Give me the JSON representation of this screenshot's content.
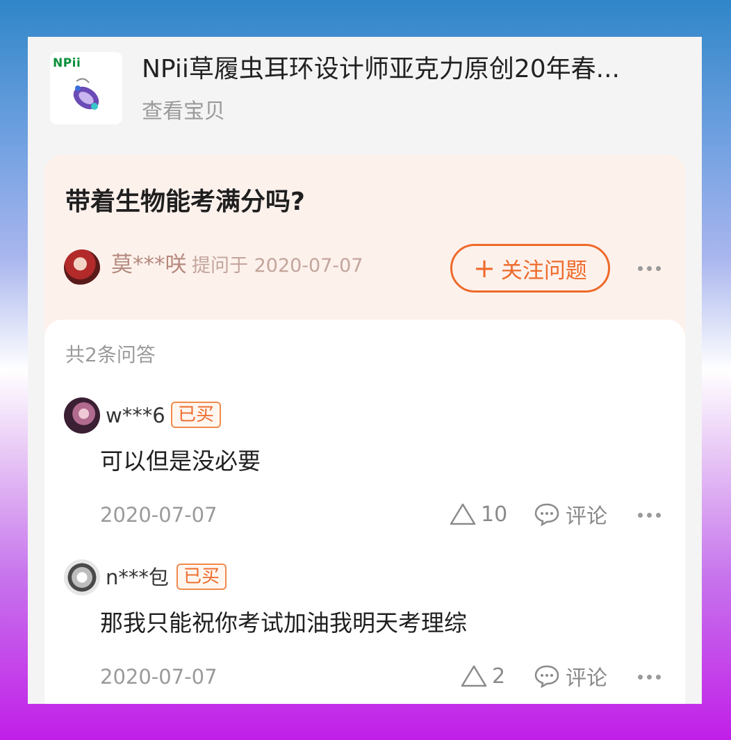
{
  "product": {
    "brand": "NPii",
    "title": "NPii草履虫耳环设计师亚克力原创20年春...",
    "link_label": "查看宝贝"
  },
  "question": {
    "text": "带着生物能考满分吗?",
    "asker_name": "莫***咲",
    "asker_meta": "提问于 2020-07-07",
    "follow_plus": "+",
    "follow_label": "关注问题"
  },
  "answers": {
    "count_label": "共2条问答",
    "items": [
      {
        "user": "w***6",
        "badge": "已买",
        "text": "可以但是没必要",
        "date": "2020-07-07",
        "likes": "10",
        "comment_label": "评论"
      },
      {
        "user": "n***包",
        "badge": "已买",
        "text": "那我只能祝你考试加油我明天考理综",
        "date": "2020-07-07",
        "likes": "2",
        "comment_label": "评论"
      }
    ]
  },
  "colors": {
    "accent": "#ee6a2a",
    "question_bg": "#fdf1ec",
    "brand_green": "#0a8f3a"
  },
  "icons": {
    "more": "more-dots-icon",
    "like": "triangle-like-icon",
    "comment": "speech-bubble-icon"
  }
}
